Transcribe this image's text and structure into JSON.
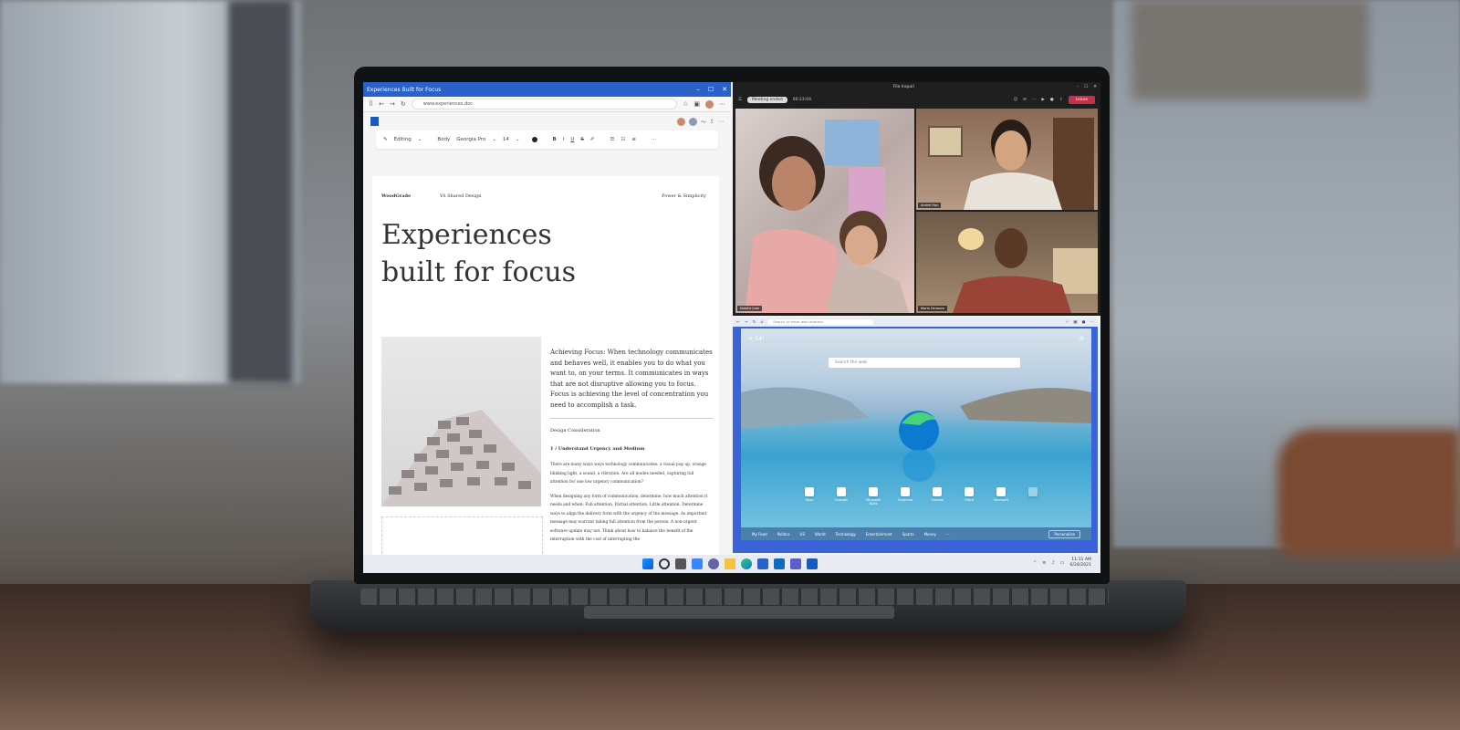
{
  "word": {
    "window_title": "Experiences Built for Focus",
    "url": "www.experiences.doc",
    "editing_label": "Editing",
    "style_label": "Body",
    "font_name": "Georgia Pro",
    "font_size": "14",
    "bold_label": "B",
    "italic_label": "I",
    "underline_label": "U",
    "strike_label": "S",
    "more_label": "···"
  },
  "document": {
    "brand": "WoodGrade",
    "header_mid": "YA Shared Design",
    "header_right": "Power & Simplicity",
    "hero_line1": "Experiences",
    "hero_line2": "built for focus",
    "intro": "Achieving Focus: When technology communicates and behaves well, it enables you to do what you want to, on your terms. It communicates in ways that are not disruptive allowing you to focus. Focus is achieving the level of concentration you need to accomplish a task.",
    "section_label": "Design Consideration",
    "subheading": "1 / Understand Urgency and Medium",
    "para1": "There are many ways ways technology communicates: a visual pop up, orange blinking light, a sound, a vibration. Are all modes needed, capturing full attention for one low urgency communication?",
    "para2": "When designing any form of communication, determine, how much attention it needs and when: Full attention, Partial attention, Little attention. Determine ways to align the delivery form with the urgency of the message. As important message may warrant taking full attention from the person. A non-urgent software update may not. Think about how to balance the benefit of the interruption with the cost of interrupting the"
  },
  "teams": {
    "window_title": "File Inquiri",
    "meeting_badge": "Meeting ended",
    "timer": "00:23:04",
    "leave_label": "Leave",
    "participants": [
      "Natalie Juan",
      "Andrei Han",
      "Mario Genazzo"
    ]
  },
  "edge": {
    "url_placeholder": "Search or enter web address",
    "temp": "54°",
    "search_placeholder": "Search the web",
    "quick_links": [
      "Xbox",
      "LinkedIn",
      "Microsoft Build",
      "OneDrive",
      "Outlook",
      "Office",
      "Microsoft",
      ""
    ],
    "feed_tabs": [
      "My Feed",
      "Politics",
      "US",
      "World",
      "Technology",
      "Entertainment",
      "Sports",
      "Money",
      "···"
    ],
    "personalize_label": "Personalize"
  },
  "taskbar": {
    "time": "11:11 AM",
    "date": "6/24/2021"
  }
}
